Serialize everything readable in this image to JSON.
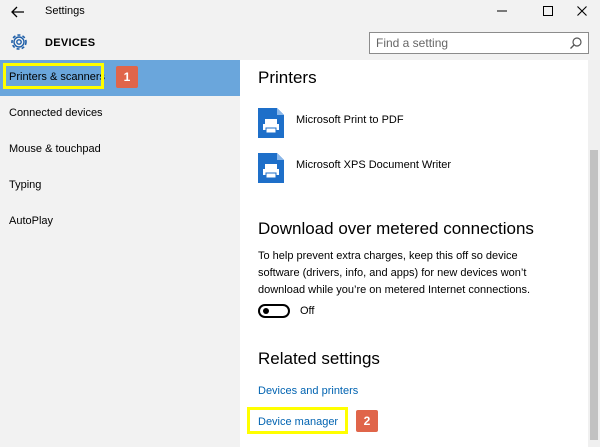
{
  "window": {
    "title": "Settings",
    "back_icon": "arrow-left-icon",
    "minimize_glyph": "—",
    "maximize_glyph": "☐",
    "close_glyph": "✕"
  },
  "header": {
    "section_title": "DEVICES",
    "section_icon": "gear-icon",
    "search_placeholder": "Find a setting"
  },
  "sidebar": {
    "items": [
      {
        "label": "Printers & scanners",
        "selected": true
      },
      {
        "label": "Connected devices"
      },
      {
        "label": "Mouse & touchpad"
      },
      {
        "label": "Typing"
      },
      {
        "label": "AutoPlay"
      }
    ],
    "selected_color": "#6aa6dc"
  },
  "content": {
    "printers_heading": "Printers",
    "printers": [
      {
        "name": "Microsoft Print to PDF"
      },
      {
        "name": "Microsoft XPS Document Writer"
      }
    ],
    "download_heading": "Download over metered connections",
    "download_text": "To help prevent extra charges, keep this off so device software (drivers, info, and apps) for new devices won’t download while you’re on metered Internet connections.",
    "toggle_state": "Off",
    "related_heading": "Related settings",
    "links": [
      {
        "label": "Devices and printers"
      },
      {
        "label": "Device manager"
      }
    ],
    "link_color": "#0063b1"
  },
  "annotations": {
    "badge_1": "1",
    "badge_2": "2",
    "highlight_color": "#ffff00",
    "badge_color": "#e0654a"
  }
}
